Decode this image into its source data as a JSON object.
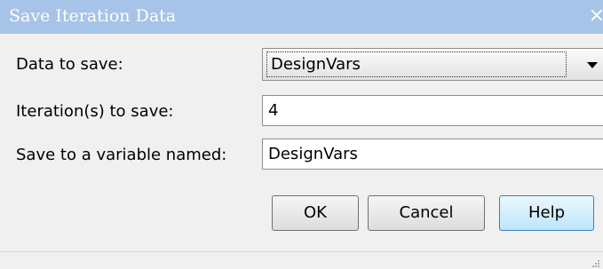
{
  "window": {
    "title": "Save Iteration Data",
    "close_glyph": "×"
  },
  "form": {
    "data_label": "Data to save:",
    "data_selected": "DesignVars",
    "iteration_label": "Iteration(s) to save:",
    "iteration_value": "4",
    "variable_label": "Save to a variable named:",
    "variable_value": "DesignVars"
  },
  "buttons": {
    "ok": "OK",
    "cancel": "Cancel",
    "help": "Help"
  },
  "icons": {
    "close": "close-icon",
    "dropdown": "chevron-down-icon",
    "resize": "resize-grip-icon"
  },
  "colors": {
    "titlebar": "#a6c4e7",
    "help_button": "#bee6fd"
  }
}
